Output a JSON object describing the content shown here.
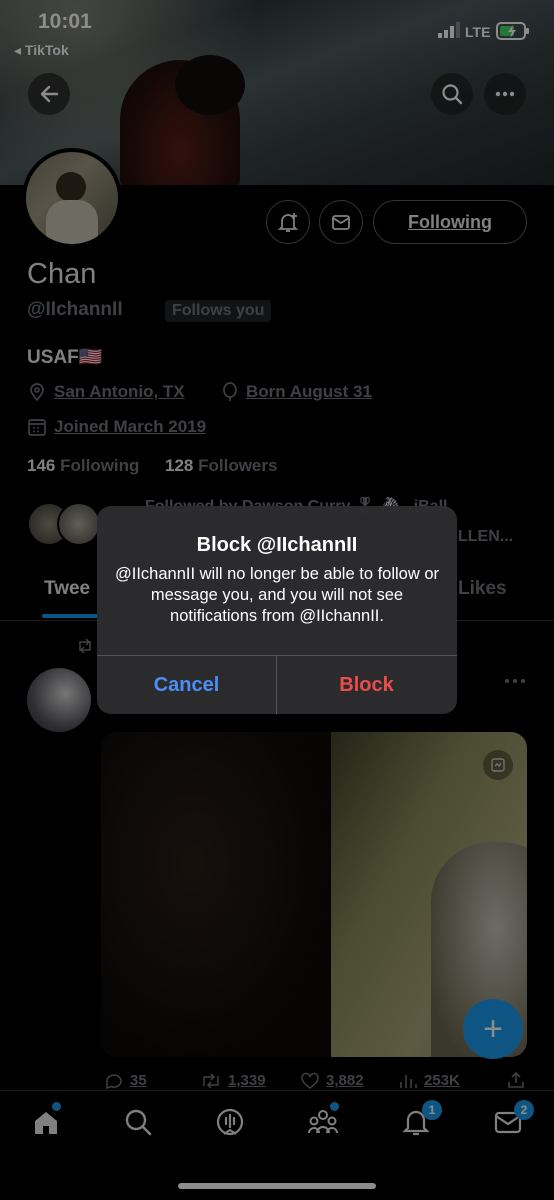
{
  "status_bar": {
    "time": "10:01",
    "back_app": "◂ TikTok",
    "network": "LTE"
  },
  "profile": {
    "name": "Chan",
    "handle": "@IIchannII",
    "follows_you": "Follows you",
    "bio": "USAF🇺🇸",
    "location": "San Antonio, TX",
    "birthday": "Born August 31",
    "joined": "Joined March 2019",
    "following_count": "146",
    "following_label": "Following",
    "followers_count": "128",
    "followers_label": "Followers",
    "followed_by_line1": "Followed by Dawson Curry 🎖 🦓 - iBall,",
    "followed_by_line2": "LLEN...",
    "follow_button": "Following"
  },
  "tabs": {
    "tweets": "Twee",
    "likes": "Likes"
  },
  "alert": {
    "title": "Block @IIchannII",
    "message": "@IIchannII will no longer be able to follow or message you, and you will not see notifications from @IIchannII.",
    "cancel": "Cancel",
    "confirm": "Block"
  },
  "tweet": {
    "replies": "35",
    "retweets": "1,339",
    "likes": "3,882",
    "views": "253K"
  },
  "fab_label": "+",
  "nav": {
    "notifications_badge": "1",
    "messages_badge": "2"
  },
  "colors": {
    "accent": "#1d9bf0",
    "destructive": "#eb4d4b",
    "cancel": "#3b82f6"
  }
}
